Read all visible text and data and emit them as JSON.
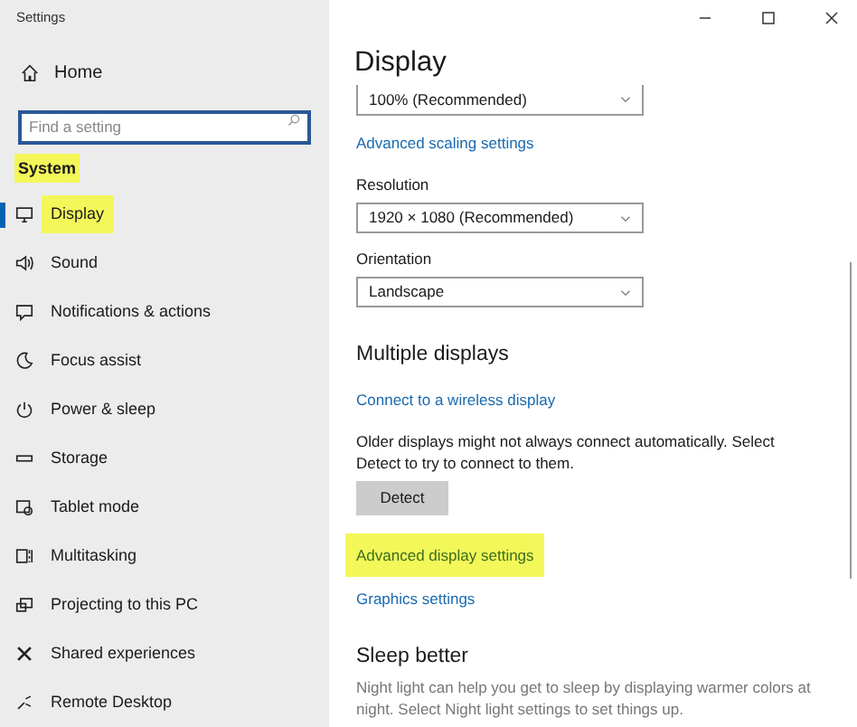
{
  "window": {
    "title": "Settings"
  },
  "sidebar": {
    "home": {
      "label": "Home"
    },
    "search": {
      "placeholder": "Find a setting"
    },
    "section": {
      "label": "System",
      "highlighted": true
    },
    "items": [
      {
        "label": "Display",
        "selected": true,
        "highlighted": true
      },
      {
        "label": "Sound",
        "selected": false,
        "highlighted": false
      },
      {
        "label": "Notifications & actions",
        "selected": false,
        "highlighted": false
      },
      {
        "label": "Focus assist",
        "selected": false,
        "highlighted": false
      },
      {
        "label": "Power & sleep",
        "selected": false,
        "highlighted": false
      },
      {
        "label": "Storage",
        "selected": false,
        "highlighted": false
      },
      {
        "label": "Tablet mode",
        "selected": false,
        "highlighted": false
      },
      {
        "label": "Multitasking",
        "selected": false,
        "highlighted": false
      },
      {
        "label": "Projecting to this PC",
        "selected": false,
        "highlighted": false
      },
      {
        "label": "Shared experiences",
        "selected": false,
        "highlighted": false
      },
      {
        "label": "Remote Desktop",
        "selected": false,
        "highlighted": false
      }
    ]
  },
  "main": {
    "title": "Display",
    "items": [
      {
        "kind": "dropdown",
        "value": "100% (Recommended)"
      },
      {
        "kind": "link",
        "text": "Advanced scaling settings",
        "highlighted": false
      },
      {
        "kind": "label",
        "text": "Resolution"
      },
      {
        "kind": "dropdown",
        "value": "1920 × 1080 (Recommended)"
      },
      {
        "kind": "label",
        "text": "Orientation"
      },
      {
        "kind": "dropdown",
        "value": "Landscape"
      },
      {
        "kind": "heading",
        "text": "Multiple displays"
      },
      {
        "kind": "link",
        "text": "Connect to a wireless display",
        "highlighted": false
      },
      {
        "kind": "text",
        "text": "Older displays might not always connect automatically. Select Detect to try to connect to them."
      },
      {
        "kind": "button",
        "text": "Detect"
      },
      {
        "kind": "link",
        "text": "Advanced display settings",
        "highlighted": true
      },
      {
        "kind": "link",
        "text": "Graphics settings",
        "highlighted": false
      },
      {
        "kind": "heading",
        "text": "Sleep better"
      },
      {
        "kind": "note",
        "text": "Night light can help you get to sleep by displaying warmer colors at night. Select Night light settings to set things up."
      }
    ]
  }
}
